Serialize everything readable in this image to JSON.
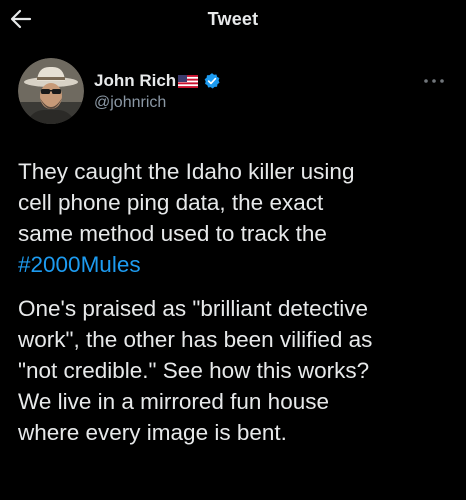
{
  "header": {
    "title": "Tweet"
  },
  "author": {
    "display_name": "John Rich",
    "handle": "@johnrich",
    "verified": true
  },
  "tweet": {
    "paragraph1_text": "They caught the Idaho killer using\ncell phone ping data, the exact\nsame method used to track the\n",
    "hashtag": "#2000Mules",
    "paragraph2_text": "One's praised as \"brilliant detective\nwork\", the other has been vilified as\n\"not credible.\" See how this works?\nWe live in a mirrored fun house\nwhere every image is bent."
  },
  "icons": {
    "back": "arrow-left-icon",
    "flag": "us-flag-icon",
    "verified": "verified-badge-icon",
    "more": "more-horizontal-icon"
  },
  "colors": {
    "background": "#000000",
    "text": "#e7e9ea",
    "secondary_text": "#8b98a5",
    "link": "#1d9bf0",
    "verified_badge": "#1d9bf0"
  }
}
